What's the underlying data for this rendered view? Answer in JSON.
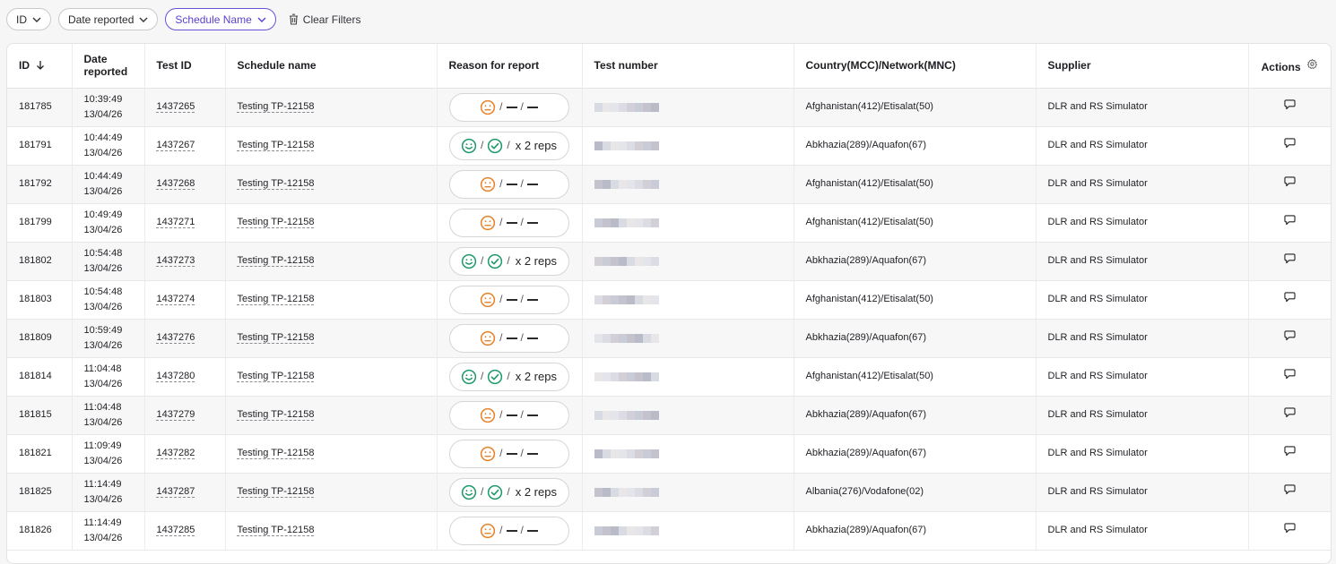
{
  "filters": {
    "id_label": "ID",
    "date_label": "Date reported",
    "schedule_label": "Schedule Name",
    "clear_label": "Clear Filters"
  },
  "columns": {
    "id": "ID",
    "date": "Date reported",
    "test_id": "Test ID",
    "schedule": "Schedule name",
    "reason": "Reason for report",
    "test_number": "Test number",
    "country": "Country(MCC)/Network(MNC)",
    "supplier": "Supplier",
    "actions": "Actions"
  },
  "colors": {
    "accent": "#5b3fd0",
    "neutral_face": "#e8822a",
    "happy_face": "#1f9a6a"
  },
  "icons": {
    "sort": "arrow-down-icon",
    "chevron": "chevron-down-icon",
    "trash": "trash-icon",
    "gear": "gear-icon",
    "comment": "comment-icon",
    "neutral": "neutral-face-icon",
    "happy": "happy-face-icon",
    "check": "check-circle-icon"
  },
  "rows": [
    {
      "id": "181785",
      "time": "10:39:49",
      "date": "13/04/26",
      "test_id": "1437265",
      "schedule": "Testing TP-12158",
      "status": "neutral",
      "reps": "",
      "country": "Afghanistan(412)/Etisalat(50)",
      "supplier": "DLR and RS Simulator"
    },
    {
      "id": "181791",
      "time": "10:44:49",
      "date": "13/04/26",
      "test_id": "1437267",
      "schedule": "Testing TP-12158",
      "status": "ok",
      "reps": "x 2 reps",
      "country": "Abkhazia(289)/Aquafon(67)",
      "supplier": "DLR and RS Simulator"
    },
    {
      "id": "181792",
      "time": "10:44:49",
      "date": "13/04/26",
      "test_id": "1437268",
      "schedule": "Testing TP-12158",
      "status": "neutral",
      "reps": "",
      "country": "Afghanistan(412)/Etisalat(50)",
      "supplier": "DLR and RS Simulator"
    },
    {
      "id": "181799",
      "time": "10:49:49",
      "date": "13/04/26",
      "test_id": "1437271",
      "schedule": "Testing TP-12158",
      "status": "neutral",
      "reps": "",
      "country": "Afghanistan(412)/Etisalat(50)",
      "supplier": "DLR and RS Simulator"
    },
    {
      "id": "181802",
      "time": "10:54:48",
      "date": "13/04/26",
      "test_id": "1437273",
      "schedule": "Testing TP-12158",
      "status": "ok",
      "reps": "x 2 reps",
      "country": "Abkhazia(289)/Aquafon(67)",
      "supplier": "DLR and RS Simulator"
    },
    {
      "id": "181803",
      "time": "10:54:48",
      "date": "13/04/26",
      "test_id": "1437274",
      "schedule": "Testing TP-12158",
      "status": "neutral",
      "reps": "",
      "country": "Afghanistan(412)/Etisalat(50)",
      "supplier": "DLR and RS Simulator"
    },
    {
      "id": "181809",
      "time": "10:59:49",
      "date": "13/04/26",
      "test_id": "1437276",
      "schedule": "Testing TP-12158",
      "status": "neutral",
      "reps": "",
      "country": "Abkhazia(289)/Aquafon(67)",
      "supplier": "DLR and RS Simulator"
    },
    {
      "id": "181814",
      "time": "11:04:48",
      "date": "13/04/26",
      "test_id": "1437280",
      "schedule": "Testing TP-12158",
      "status": "ok",
      "reps": "x 2 reps",
      "country": "Afghanistan(412)/Etisalat(50)",
      "supplier": "DLR and RS Simulator"
    },
    {
      "id": "181815",
      "time": "11:04:48",
      "date": "13/04/26",
      "test_id": "1437279",
      "schedule": "Testing TP-12158",
      "status": "neutral",
      "reps": "",
      "country": "Abkhazia(289)/Aquafon(67)",
      "supplier": "DLR and RS Simulator"
    },
    {
      "id": "181821",
      "time": "11:09:49",
      "date": "13/04/26",
      "test_id": "1437282",
      "schedule": "Testing TP-12158",
      "status": "neutral",
      "reps": "",
      "country": "Abkhazia(289)/Aquafon(67)",
      "supplier": "DLR and RS Simulator"
    },
    {
      "id": "181825",
      "time": "11:14:49",
      "date": "13/04/26",
      "test_id": "1437287",
      "schedule": "Testing TP-12158",
      "status": "ok",
      "reps": "x 2 reps",
      "country": "Albania(276)/Vodafone(02)",
      "supplier": "DLR and RS Simulator"
    },
    {
      "id": "181826",
      "time": "11:14:49",
      "date": "13/04/26",
      "test_id": "1437285",
      "schedule": "Testing TP-12158",
      "status": "neutral",
      "reps": "",
      "country": "Abkhazia(289)/Aquafon(67)",
      "supplier": "DLR and RS Simulator"
    }
  ]
}
